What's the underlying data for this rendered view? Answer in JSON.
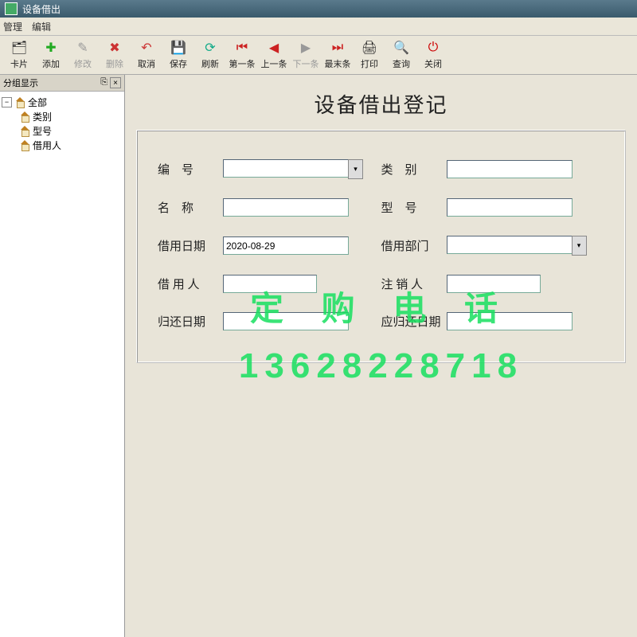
{
  "window": {
    "title": "设备借出"
  },
  "menu": {
    "manage": "管理",
    "edit": "编辑"
  },
  "toolbar": {
    "card": "卡片",
    "add": "添加",
    "modify": "修改",
    "delete": "删除",
    "cancel": "取消",
    "save": "保存",
    "refresh": "刷新",
    "first": "第一条",
    "prev": "上一条",
    "next": "下一条",
    "last": "最末条",
    "print": "打印",
    "query": "查询",
    "close": "关闭"
  },
  "sidebar": {
    "header": "分组显示",
    "root": "全部",
    "children": [
      "类别",
      "型号",
      "借用人"
    ]
  },
  "page": {
    "title": "设备借出登记"
  },
  "form": {
    "number_label": "编　号",
    "category_label": "类　别",
    "name_label": "名　称",
    "model_label": "型　号",
    "borrow_date_label": "借用日期",
    "borrow_date_value": "2020-08-29",
    "borrow_dept_label": "借用部门",
    "borrower_label": "借 用 人",
    "canceller_label": "注 销 人",
    "return_date_label": "归还日期",
    "due_date_label": "应归还日期"
  },
  "watermark": {
    "line1": "定 购 电 话",
    "line2": "13628228718"
  }
}
